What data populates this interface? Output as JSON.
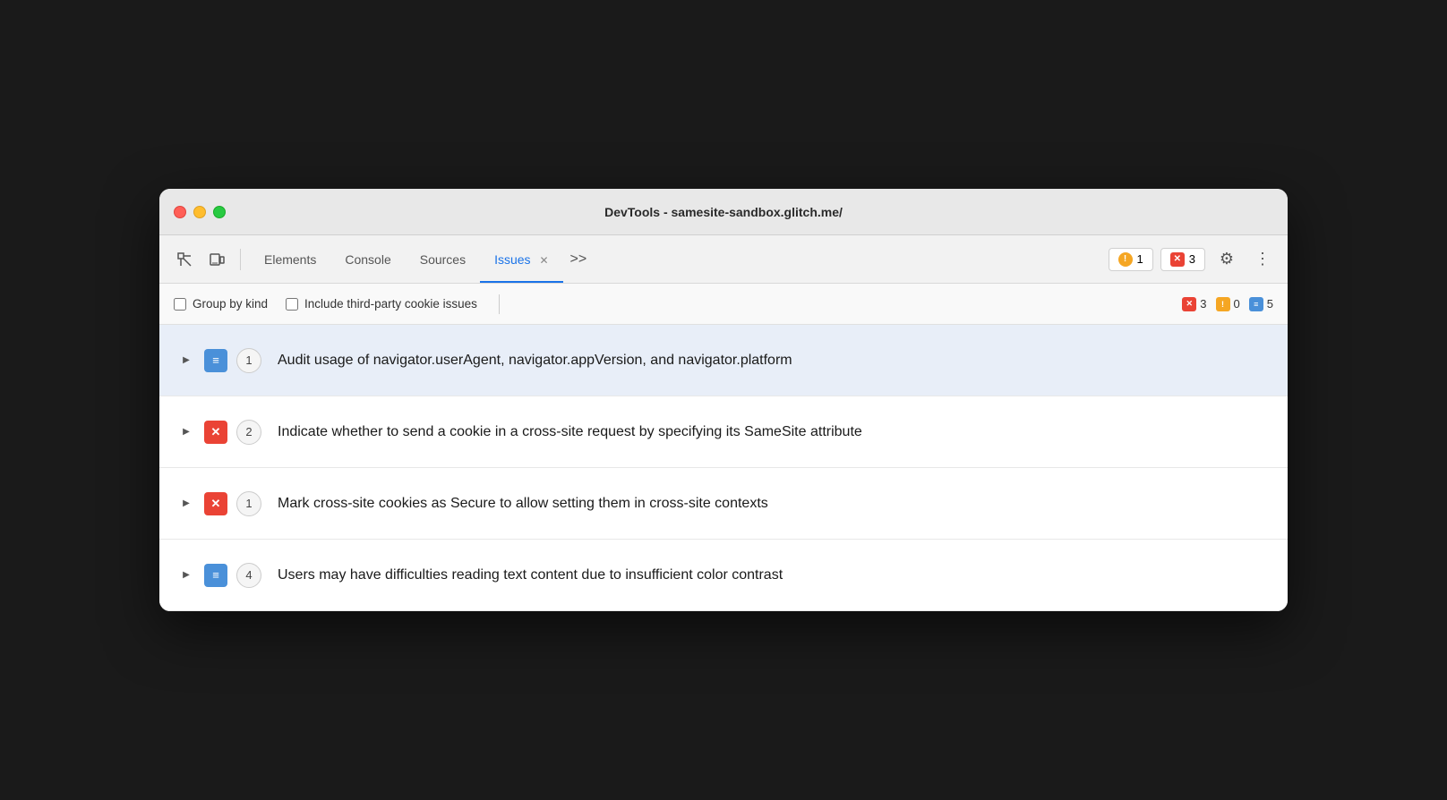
{
  "window": {
    "title": "DevTools - samesite-sandbox.glitch.me/"
  },
  "toolbar": {
    "elements_label": "Elements",
    "console_label": "Console",
    "sources_label": "Sources",
    "issues_label": "Issues",
    "more_tabs_label": ">>",
    "warn_count": "1",
    "error_count": "3"
  },
  "filter_bar": {
    "group_by_kind_label": "Group by kind",
    "third_party_label": "Include third-party cookie issues",
    "error_count": "3",
    "warn_count": "0",
    "info_count": "5"
  },
  "issues": [
    {
      "id": "issue-1",
      "type": "info",
      "count": "1",
      "text": "Audit usage of navigator.userAgent, navigator.appVersion, and navigator.platform",
      "highlighted": true
    },
    {
      "id": "issue-2",
      "type": "error",
      "count": "2",
      "text": "Indicate whether to send a cookie in a cross-site request by specifying its SameSite attribute",
      "highlighted": false
    },
    {
      "id": "issue-3",
      "type": "error",
      "count": "1",
      "text": "Mark cross-site cookies as Secure to allow setting them in cross-site contexts",
      "highlighted": false
    },
    {
      "id": "issue-4",
      "type": "info",
      "count": "4",
      "text": "Users may have difficulties reading text content due to insufficient color contrast",
      "highlighted": false
    }
  ],
  "icons": {
    "info_symbol": "≡",
    "error_symbol": "✕",
    "warn_symbol": "!"
  }
}
